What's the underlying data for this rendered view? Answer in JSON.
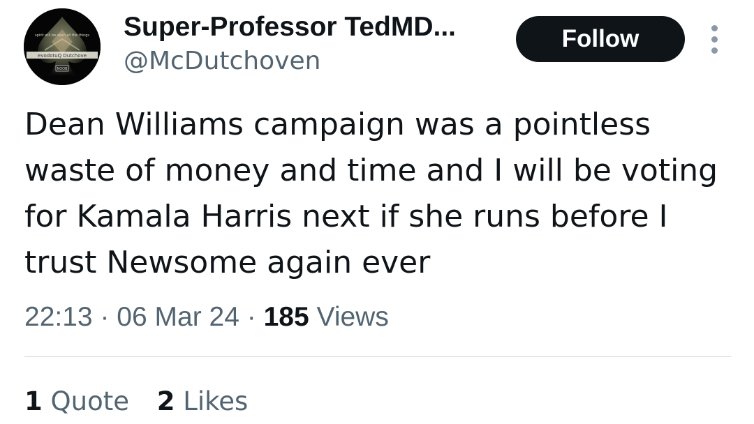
{
  "author": {
    "display_name": "Super-Professor TedMD...",
    "handle": "@McDutchoven",
    "avatar": {
      "icon": "spade-icon",
      "text_top": "spirit will be seen all the things",
      "text_band": "evodotuQ Dutchove",
      "text_small": "NOOB"
    }
  },
  "actions": {
    "follow_label": "Follow",
    "more_icon": "more-vertical-icon"
  },
  "tweet": {
    "text": "Dean Williams campaign was a pointless waste of money and time and I will be voting for Kamala Harris next if she runs before I trust Newsome again ever",
    "time": "22:13",
    "date": "06 Mar 24",
    "separator": "·",
    "views_count": "185",
    "views_label": "Views"
  },
  "engagement": {
    "quotes_count": "1",
    "quotes_label": "Quote",
    "likes_count": "2",
    "likes_label": "Likes"
  },
  "colors": {
    "text_primary": "#0f1419",
    "text_secondary": "#536471",
    "button_bg": "#0f1419",
    "button_text": "#ffffff",
    "divider": "#d9dde0"
  }
}
